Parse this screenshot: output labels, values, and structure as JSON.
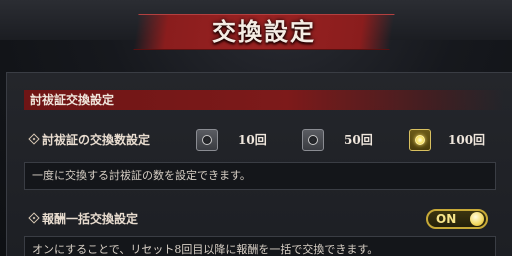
{
  "header": {
    "title": "交換設定"
  },
  "section": {
    "title": "討祓証交換設定"
  },
  "exchange_count": {
    "label": "討祓証の交換数設定",
    "options": [
      {
        "label": "10回",
        "selected": false
      },
      {
        "label": "50回",
        "selected": false
      },
      {
        "label": "100回",
        "selected": true
      }
    ],
    "description": "一度に交換する討祓証の数を設定できます。"
  },
  "bulk_exchange": {
    "label": "報酬一括交換設定",
    "toggle_label": "ON",
    "toggle_on": true,
    "description": "オンにすることで、リセット8回目以降に報酬を一括で交換できます。"
  },
  "colors": {
    "accent_red": "#8a1d1d",
    "accent_gold": "#c8aa38",
    "panel": "#1d1f24"
  }
}
